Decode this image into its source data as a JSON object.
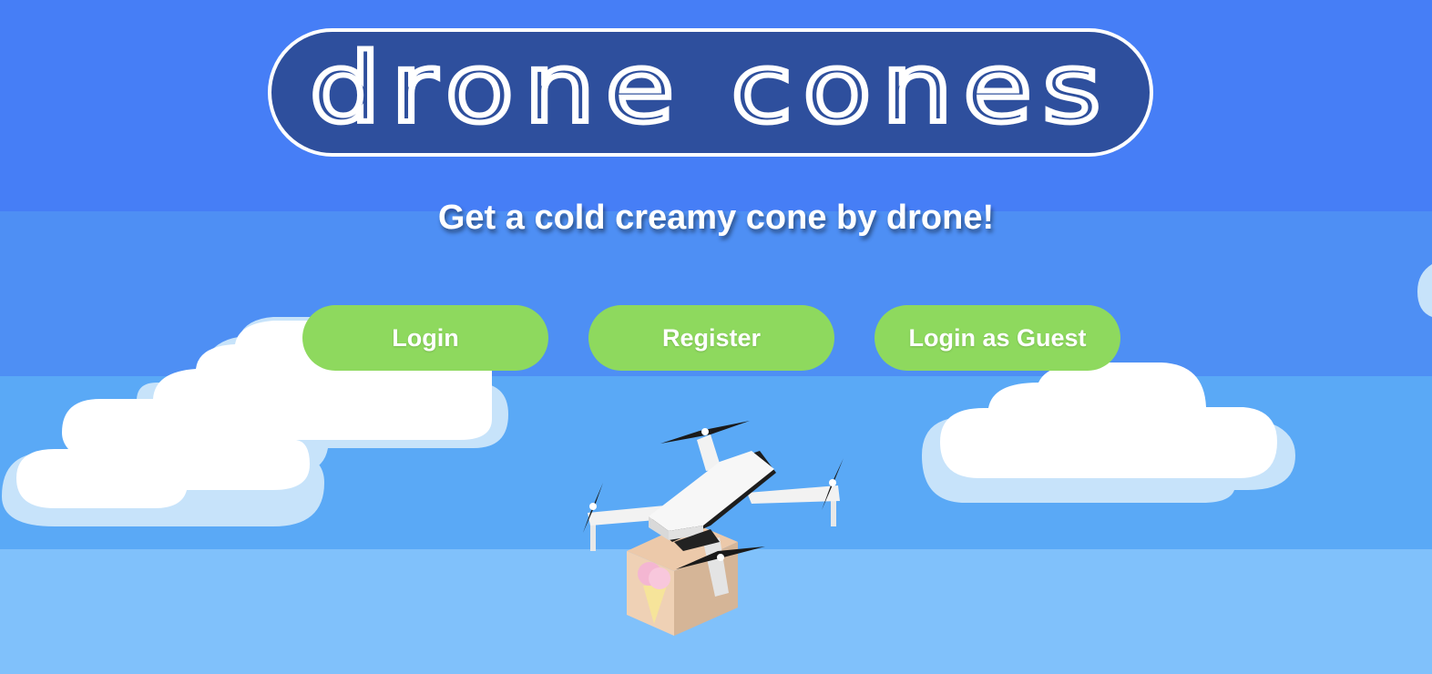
{
  "app": {
    "logo_text": "drone cones",
    "tagline": "Get a cold creamy cone by drone!"
  },
  "actions": {
    "login_label": "Login",
    "register_label": "Register",
    "guest_label": "Login as Guest"
  },
  "illustration": {
    "subject": "drone-carrying-ice-cream-box-icon"
  },
  "colors": {
    "sky_top": "#467ef6",
    "logo_background": "#2e4f9d",
    "button_green": "#8ed95e",
    "cloud_white": "#ffffff",
    "cloud_shadow": "#c7e3fa"
  }
}
